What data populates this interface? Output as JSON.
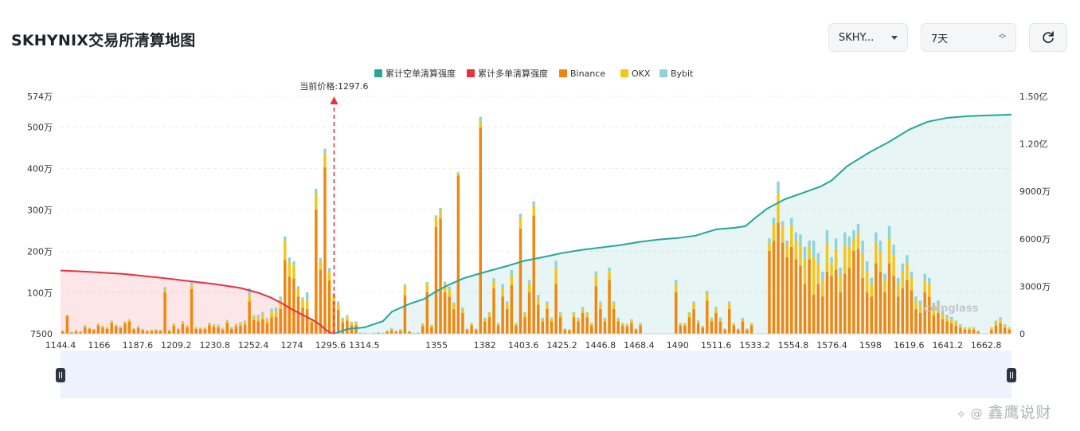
{
  "page": {
    "title": "SKHYNIX交易所清算地图",
    "symbol_select": "SKHY...",
    "range_select": "7天",
    "watermark": "鑫鹰说财",
    "chart_logo": "coinglass"
  },
  "colors": {
    "short_cum": "#26a69a",
    "long_cum": "#e8313f",
    "binance": "#f0860d",
    "okx": "#f5c518",
    "bybit": "#8dd3df",
    "price_line": "#e8313f"
  },
  "chart_data": {
    "type": "bar",
    "current_price": 1297.6,
    "current_price_label": "当前价格:1297.6",
    "legend": [
      "累计空单清算强度",
      "累计多单清算强度",
      "Binance",
      "OKX",
      "Bybit"
    ],
    "y_left_ticks": [
      "7500",
      "100万",
      "200万",
      "300万",
      "400万",
      "500万",
      "574万"
    ],
    "y_left_tick_values": [
      7500,
      1000000,
      2000000,
      3000000,
      4000000,
      5000000,
      5740000
    ],
    "y_left_range": [
      7500,
      5740000
    ],
    "y_right_ticks": [
      "0",
      "3000万",
      "6000万",
      "9000万",
      "1.20亿",
      "1.50亿"
    ],
    "y_right_tick_values": [
      0,
      30000000,
      60000000,
      90000000,
      120000000,
      150000000
    ],
    "y_right_range": [
      0,
      150000000
    ],
    "x_ticks": [
      "1144.4",
      "1166",
      "1187.6",
      "1209.2",
      "1230.8",
      "1252.4",
      "1274",
      "1295.6",
      "1314.5",
      "1355",
      "1382",
      "1403.6",
      "1425.2",
      "1446.8",
      "1468.4",
      "1490",
      "1511.6",
      "1533.2",
      "1554.8",
      "1576.4",
      "1598",
      "1619.6",
      "1641.2",
      "1662.8"
    ],
    "x_range": [
      1144.4,
      1677
    ],
    "binance": [
      60,
      430,
      30,
      60,
      40,
      160,
      120,
      90,
      200,
      150,
      120,
      260,
      180,
      140,
      240,
      290,
      110,
      140,
      90,
      60,
      70,
      80,
      70,
      1000,
      70,
      190,
      100,
      230,
      160,
      1080,
      120,
      110,
      110,
      210,
      170,
      160,
      100,
      260,
      120,
      180,
      200,
      220,
      780,
      330,
      300,
      350,
      250,
      400,
      410,
      600,
      1780,
      1380,
      1340,
      900,
      640,
      600,
      280,
      3000,
      1550,
      4020,
      1290,
      780,
      580,
      280,
      320,
      200,
      210,
      10,
      10,
      0,
      10,
      20,
      10,
      50,
      90,
      50,
      70,
      930,
      50,
      10,
      20,
      190,
      1000,
      160,
      2580,
      2780,
      1000,
      900,
      600,
      3820,
      500,
      100,
      200,
      100,
      4980,
      300,
      400,
      1100,
      200,
      900,
      600,
      1180,
      200,
      2540,
      400,
      1000,
      2860,
      700,
      300,
      600,
      300,
      1200,
      400,
      100,
      80,
      400,
      300,
      500,
      400,
      200,
      1150,
      600,
      300,
      1300,
      600,
      300,
      200,
      180,
      260,
      100,
      200,
      0,
      0,
      0,
      0,
      0,
      0,
      0,
      1000,
      200,
      200,
      400,
      600,
      250,
      150,
      800,
      300,
      500,
      300,
      100,
      600,
      200,
      100,
      300,
      100,
      200,
      0,
      0,
      0,
      2000,
      2250,
      2680,
      2200,
      1850,
      2100,
      1800,
      1650,
      1200,
      1800,
      950,
      1200,
      900,
      1500,
      1400,
      1550,
      1000,
      1450,
      1600,
      2000,
      2050,
      1350,
      1000,
      900,
      1700,
      1500,
      1000,
      1700,
      1400,
      900,
      1100,
      1300,
      1050,
      600,
      500,
      1000,
      900,
      450,
      500,
      350,
      300,
      250,
      200,
      150,
      100,
      100,
      100,
      50,
      0,
      0,
      100,
      200,
      250,
      150,
      100
    ],
    "okx": [
      10,
      20,
      10,
      20,
      10,
      30,
      20,
      20,
      30,
      30,
      30,
      40,
      30,
      30,
      40,
      40,
      20,
      30,
      20,
      20,
      20,
      20,
      20,
      80,
      20,
      40,
      20,
      50,
      30,
      100,
      30,
      30,
      30,
      40,
      40,
      40,
      30,
      50,
      30,
      40,
      50,
      60,
      160,
      80,
      100,
      100,
      80,
      130,
      140,
      200,
      470,
      360,
      320,
      200,
      180,
      200,
      60,
      380,
      200,
      340,
      200,
      150,
      140,
      80,
      90,
      60,
      60,
      10,
      10,
      0,
      10,
      10,
      10,
      20,
      30,
      20,
      30,
      230,
      10,
      5,
      5,
      40,
      200,
      40,
      220,
      200,
      200,
      180,
      120,
      60,
      100,
      20,
      40,
      20,
      160,
      60,
      80,
      160,
      40,
      200,
      120,
      240,
      40,
      280,
      80,
      200,
      240,
      160,
      60,
      120,
      60,
      400,
      80,
      20,
      20,
      80,
      60,
      100,
      80,
      40,
      260,
      120,
      60,
      200,
      120,
      60,
      40,
      40,
      60,
      20,
      40,
      0,
      0,
      0,
      0,
      0,
      0,
      0,
      200,
      40,
      40,
      80,
      120,
      50,
      30,
      160,
      60,
      100,
      60,
      20,
      120,
      40,
      20,
      60,
      20,
      40,
      0,
      0,
      0,
      200,
      400,
      700,
      400,
      300,
      500,
      450,
      500,
      600,
      300,
      900,
      500,
      400,
      700,
      300,
      500,
      400,
      700,
      500,
      300,
      400,
      600,
      500,
      300,
      500,
      500,
      300,
      600,
      500,
      300,
      400,
      400,
      300,
      200,
      200,
      300,
      300,
      200,
      200,
      150,
      100,
      100,
      80,
      50,
      40,
      40,
      40,
      20,
      0,
      0,
      40,
      80,
      100,
      50,
      40
    ],
    "bybit": [
      5,
      10,
      5,
      10,
      5,
      15,
      10,
      10,
      15,
      15,
      15,
      20,
      15,
      15,
      20,
      20,
      10,
      15,
      10,
      10,
      10,
      10,
      10,
      50,
      10,
      20,
      10,
      25,
      15,
      70,
      15,
      15,
      15,
      20,
      20,
      20,
      15,
      25,
      15,
      20,
      30,
      40,
      160,
      40,
      60,
      80,
      50,
      80,
      80,
      100,
      100,
      100,
      90,
      50,
      60,
      200,
      30,
      120,
      80,
      110,
      100,
      60,
      60,
      30,
      40,
      30,
      30,
      5,
      5,
      0,
      5,
      5,
      5,
      10,
      20,
      10,
      15,
      40,
      5,
      5,
      5,
      20,
      50,
      20,
      60,
      60,
      60,
      60,
      40,
      20,
      40,
      10,
      20,
      10,
      100,
      30,
      40,
      80,
      20,
      100,
      60,
      120,
      20,
      80,
      40,
      100,
      100,
      80,
      30,
      60,
      30,
      160,
      40,
      10,
      10,
      40,
      30,
      50,
      40,
      20,
      100,
      60,
      30,
      100,
      60,
      30,
      20,
      20,
      30,
      10,
      20,
      0,
      0,
      0,
      0,
      0,
      0,
      0,
      100,
      20,
      20,
      40,
      60,
      25,
      15,
      80,
      30,
      50,
      30,
      10,
      60,
      20,
      10,
      30,
      10,
      20,
      0,
      0,
      0,
      100,
      150,
      300,
      120,
      100,
      200,
      200,
      250,
      300,
      150,
      400,
      250,
      200,
      300,
      150,
      250,
      200,
      300,
      250,
      200,
      200,
      300,
      250,
      150,
      250,
      250,
      150,
      300,
      250,
      150,
      200,
      200,
      150,
      100,
      100,
      150,
      150,
      100,
      100,
      80,
      60,
      60,
      40,
      30,
      20,
      20,
      20,
      10,
      0,
      0,
      20,
      40,
      50,
      30,
      20
    ],
    "long_cum_x": [
      1144.4,
      1160,
      1180,
      1200,
      1215,
      1230,
      1245,
      1255,
      1262,
      1268,
      1274,
      1280,
      1286,
      1290,
      1293,
      1295.6,
      1297.6
    ],
    "long_cum_y": [
      40000000,
      39200000,
      37800000,
      35500000,
      33500000,
      31500000,
      29000000,
      26000000,
      23000000,
      19500000,
      15500000,
      12000000,
      8500000,
      5500000,
      2500000,
      600000,
      0
    ],
    "short_cum_x": [
      1297.6,
      1305,
      1314.5,
      1325,
      1330,
      1340,
      1348,
      1355,
      1362,
      1370,
      1382,
      1395,
      1403.6,
      1415,
      1425.2,
      1436,
      1446.8,
      1457.6,
      1468.4,
      1479,
      1490,
      1500,
      1511.6,
      1522,
      1528,
      1533.2,
      1540,
      1550,
      1560,
      1570,
      1576.4,
      1585,
      1598,
      1608,
      1619.6,
      1630,
      1641.2,
      1652,
      1662.8,
      1677
    ],
    "short_cum_y": [
      0,
      3000000,
      4000000,
      8000000,
      14000000,
      19000000,
      22000000,
      27000000,
      31000000,
      35000000,
      39000000,
      43000000,
      46000000,
      48500000,
      51000000,
      53000000,
      54500000,
      56000000,
      58000000,
      59500000,
      60500000,
      62000000,
      66000000,
      67000000,
      68000000,
      73000000,
      79000000,
      85000000,
      89000000,
      93000000,
      97000000,
      106000000,
      115000000,
      121000000,
      129000000,
      134000000,
      136500000,
      137500000,
      138000000,
      138500000
    ]
  }
}
